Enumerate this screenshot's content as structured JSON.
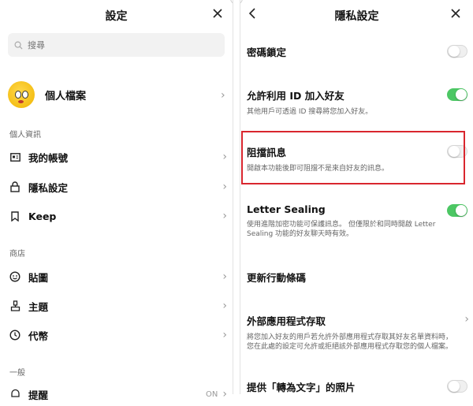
{
  "left_panel": {
    "title": "設定",
    "search_placeholder": "搜尋",
    "profile": {
      "name": "個人檔案"
    },
    "sections": [
      {
        "label": "個人資訊",
        "items": [
          {
            "label": "我的帳號",
            "icon": "id-card-icon"
          },
          {
            "label": "隱私設定",
            "icon": "lock-icon"
          },
          {
            "label": "Keep",
            "icon": "bookmark-icon"
          }
        ]
      },
      {
        "label": "商店",
        "items": [
          {
            "label": "貼圖",
            "icon": "smiley-icon"
          },
          {
            "label": "主題",
            "icon": "brush-icon"
          },
          {
            "label": "代幣",
            "icon": "coin-icon"
          }
        ]
      },
      {
        "label": "一般",
        "items": [
          {
            "label": "提醒",
            "icon": "bell-icon",
            "value": "ON"
          }
        ]
      }
    ]
  },
  "right_panel": {
    "title": "隱私設定",
    "settings": [
      {
        "title": "密碼鎖定",
        "desc": "",
        "toggle": false
      },
      {
        "title": "允許利用 ID 加入好友",
        "desc": "其他用戶可透過 ID 搜尋將您加入好友。",
        "toggle": true
      },
      {
        "title": "阻擋訊息",
        "desc": "開啟本功能後即可阻擋不是來自好友的訊息。",
        "toggle": false,
        "highlighted": true
      },
      {
        "title": "Letter Sealing",
        "desc": "使用進階加密功能可保護訊息。 但僅限於和同時開啟 Letter Sealing 功能的好友聊天時有效。",
        "toggle": true
      },
      {
        "title": "更新行動條碼",
        "desc": ""
      },
      {
        "title": "外部應用程式存取",
        "desc": "將您加入好友的用戶若允許外部應用程式存取其好友名單資料時，您在此處的設定可允許或拒絕該外部應用程式存取您的個人檔案。",
        "chevron": true
      },
      {
        "title": "提供「轉為文字」的照片",
        "desc": "",
        "toggle": false
      }
    ]
  },
  "colors": {
    "toggle_on": "#4cc764",
    "highlight": "#d9262e"
  }
}
